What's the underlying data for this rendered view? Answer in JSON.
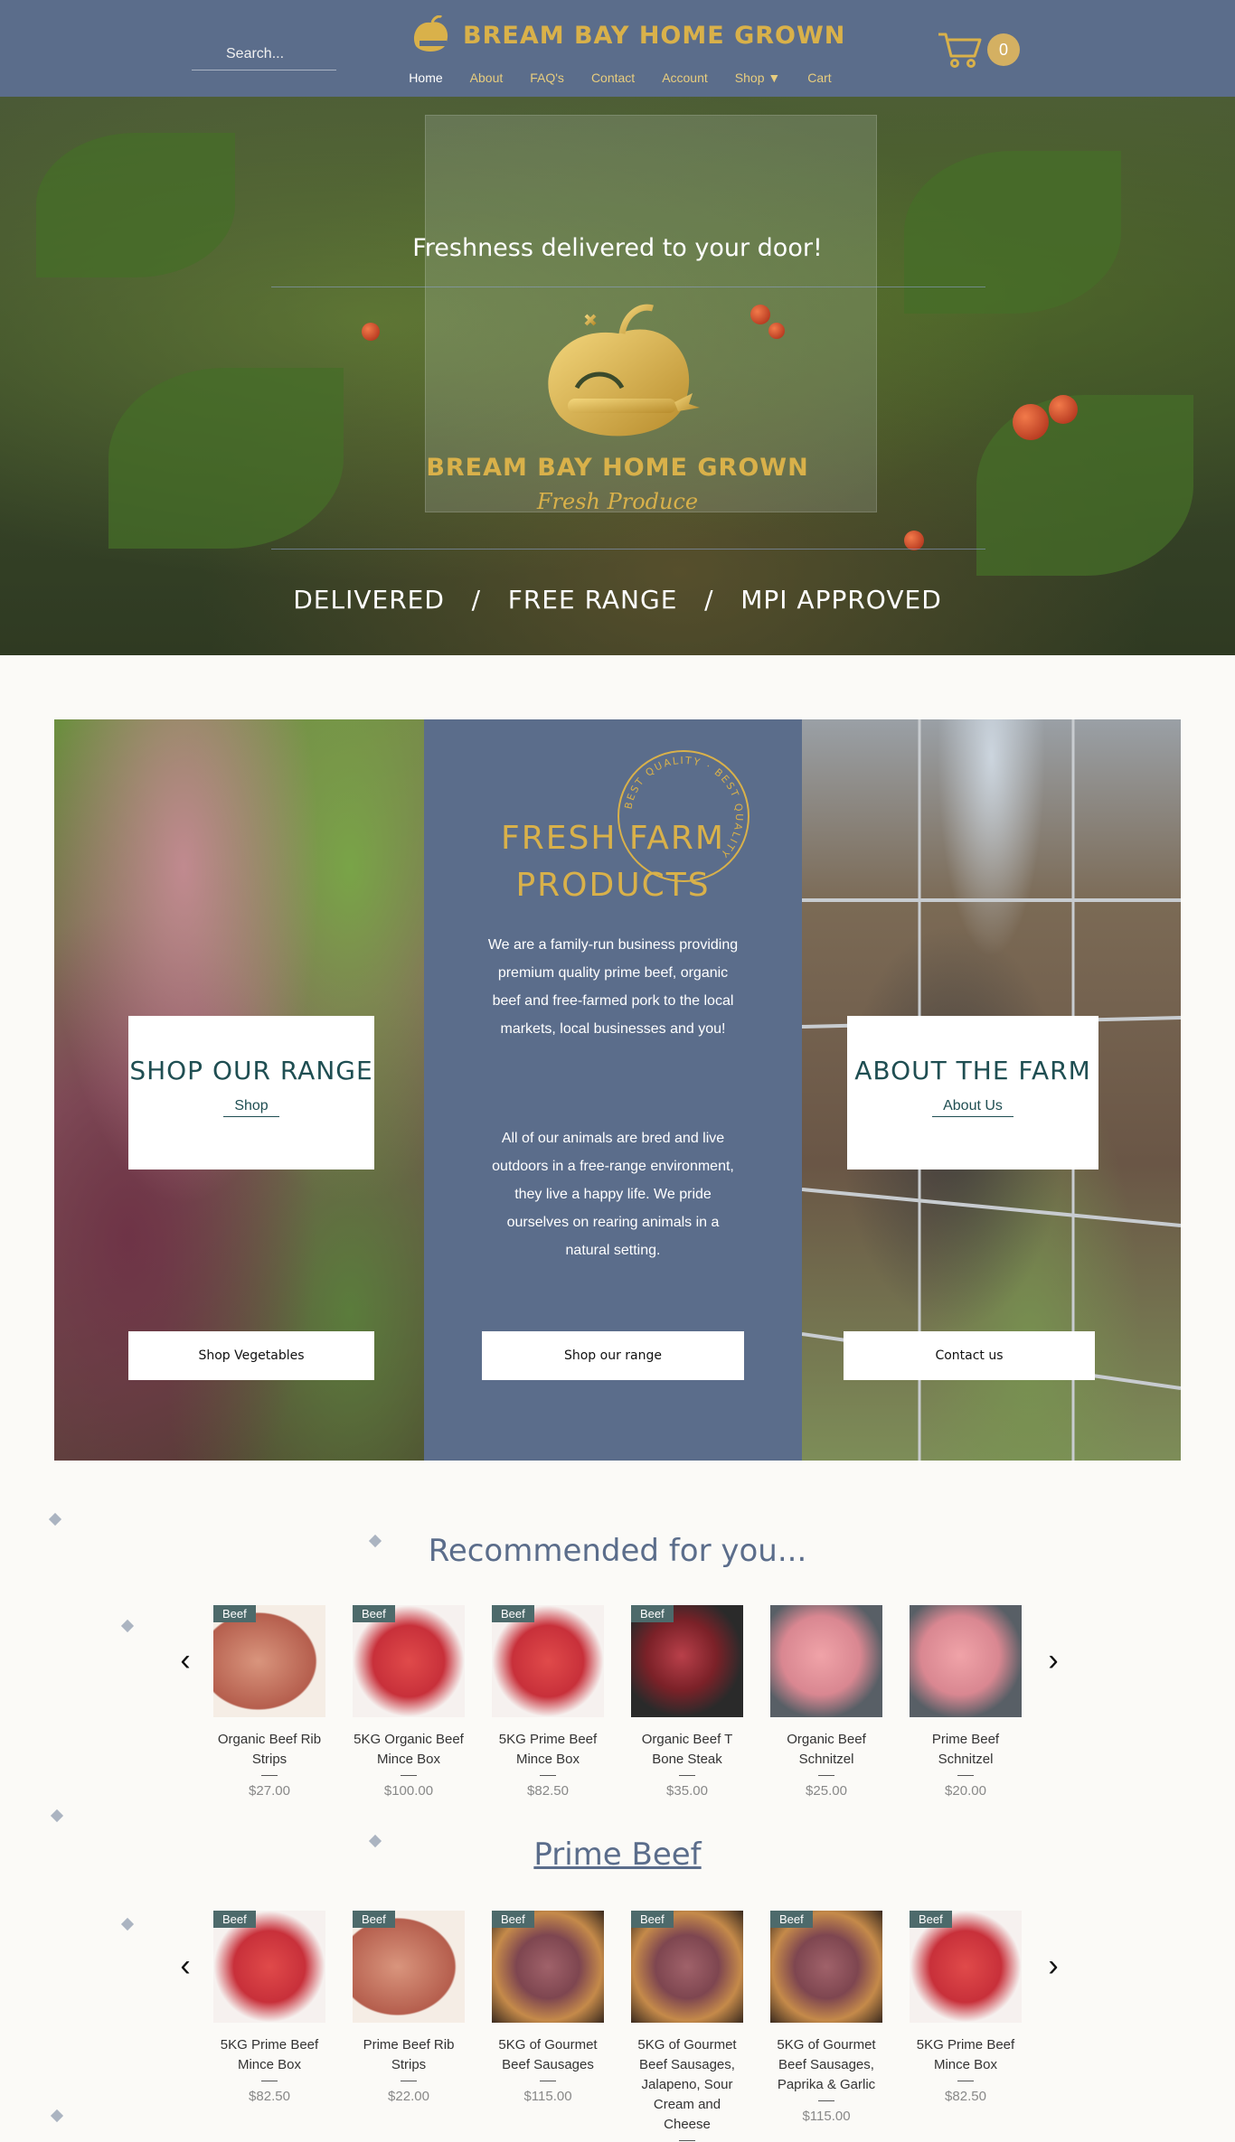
{
  "header": {
    "search_placeholder": "Search...",
    "brand": "BREAM BAY HOME GROWN",
    "nav": [
      "Home",
      "About",
      "FAQ's",
      "Contact",
      "Account",
      "Shop ▼",
      "Cart"
    ],
    "cart_count": "0"
  },
  "hero": {
    "headline": "Freshness delivered to your door!",
    "brand": "BREAM BAY HOME GROWN",
    "script": "Fresh Produce",
    "tagline": "DELIVERED   /   FREE RANGE   /   MPI APPROVED"
  },
  "panels": {
    "left": {
      "title": "SHOP OUR RANGE",
      "link": "Shop",
      "button": "Shop Vegetables"
    },
    "mid": {
      "title_1": "FRESH FARM",
      "title_2": "PRODUCTS",
      "badge": "BEST QUALITY · BEST QUALITY",
      "para_1": "We are a family-run business providing premium quality prime beef, organic beef and free-farmed pork to the local markets, local businesses and you!",
      "para_2": "All of our animals are bred and live outdoors in a free-range environment, they live a happy life. We pride ourselves on rearing animals in a natural setting.",
      "button": "Shop our range"
    },
    "right": {
      "title": "ABOUT THE FARM",
      "link": "About Us",
      "button": "Contact us"
    }
  },
  "recommended": {
    "title": "Recommended for you...",
    "products": [
      {
        "ribbon": "Beef",
        "name": "Organic Beef Rib Strips",
        "price": "$27.00",
        "img": "rib"
      },
      {
        "ribbon": "Beef",
        "name": "5KG Organic Beef Mince Box",
        "price": "$100.00",
        "img": "mince"
      },
      {
        "ribbon": "Beef",
        "name": "5KG Prime Beef Mince Box",
        "price": "$82.50",
        "img": "mince"
      },
      {
        "ribbon": "Beef",
        "name": "Organic Beef T Bone Steak",
        "price": "$35.00",
        "img": "tbone"
      },
      {
        "ribbon": "",
        "name": "Organic Beef Schnitzel",
        "price": "$25.00",
        "img": "schnitzel"
      },
      {
        "ribbon": "",
        "name": "Prime Beef Schnitzel",
        "price": "$20.00",
        "img": "schnitzel"
      }
    ]
  },
  "prime_beef": {
    "title": "Prime Beef",
    "products": [
      {
        "ribbon": "Beef",
        "name": "5KG Prime Beef Mince Box",
        "price": "$82.50",
        "img": "mince"
      },
      {
        "ribbon": "Beef",
        "name": "Prime Beef Rib Strips",
        "price": "$22.00",
        "img": "rib"
      },
      {
        "ribbon": "Beef",
        "name": "5KG of Gourmet Beef Sausages",
        "price": "$115.00",
        "img": "sausage"
      },
      {
        "ribbon": "Beef",
        "name": "5KG of Gourmet Beef Sausages, Jalapeno, Sour Cream and Cheese",
        "price": "",
        "img": "sausage"
      },
      {
        "ribbon": "Beef",
        "name": "5KG of Gourmet Beef Sausages, Paprika & Garlic",
        "price": "$115.00",
        "img": "sausage"
      },
      {
        "ribbon": "Beef",
        "name": "5KG Prime Beef Mince Box",
        "price": "$82.50",
        "img": "mince"
      }
    ]
  },
  "icons": {
    "search": "search-icon",
    "cart": "cart-icon",
    "prev": "chevron-left-icon",
    "next": "chevron-right-icon"
  },
  "colors": {
    "header": "#5b6d8b",
    "gold": "#d9b14a",
    "teal": "#1f4e52",
    "ribbon": "#4d6a6b"
  }
}
